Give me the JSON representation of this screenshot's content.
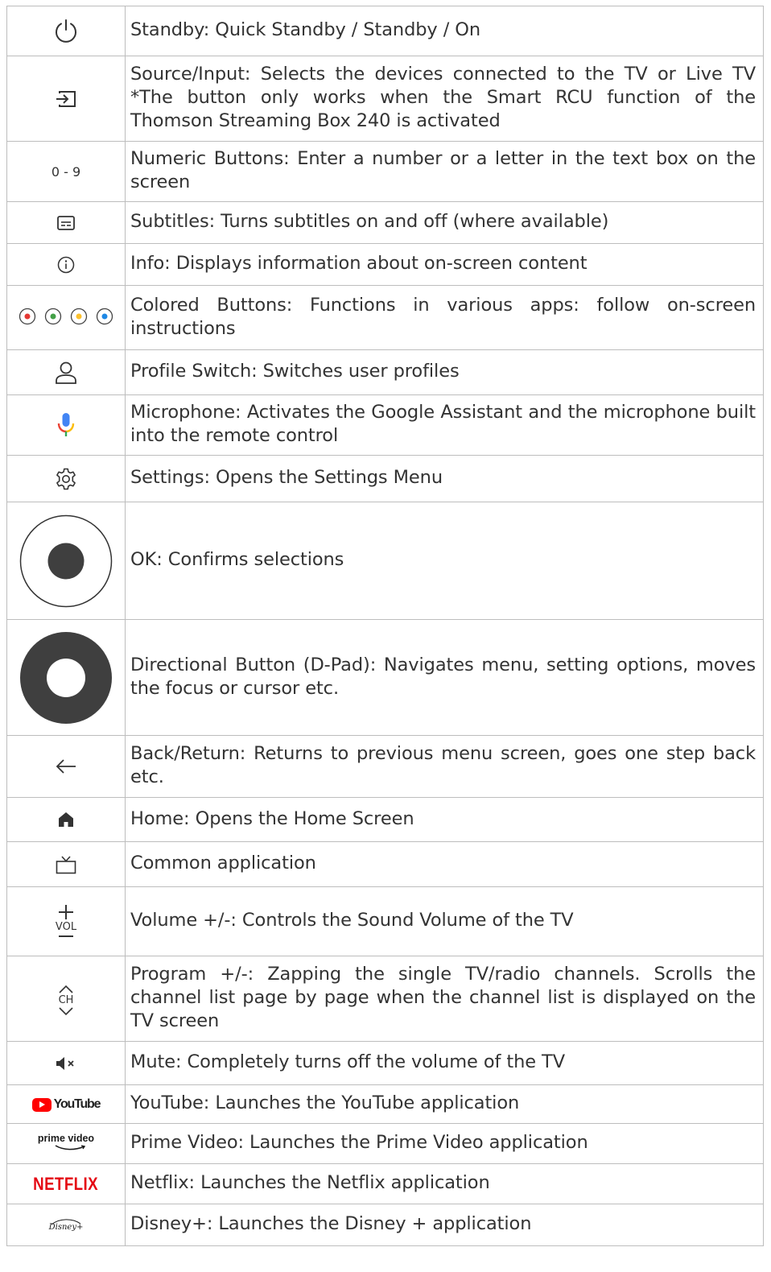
{
  "rows": [
    {
      "icon": "power-icon",
      "description": "Standby: Quick Standby / Standby / On"
    },
    {
      "icon": "source-input-icon",
      "description": "Source/Input: Selects the devices connected to the TV or Live TV *The button only works when the Smart RCU function of the Thomson Streaming Box 240 is activated"
    },
    {
      "icon": "numeric-text",
      "icon_text": "0 - 9",
      "description": "Numeric Buttons: Enter a number or a letter in the text box on the screen"
    },
    {
      "icon": "subtitles-icon",
      "description": "Subtitles: Turns subtitles on and off (where available)"
    },
    {
      "icon": "info-icon",
      "description": "Info: Displays information about on-screen content"
    },
    {
      "icon": "colored-buttons-icon",
      "colors": [
        "#e53935",
        "#43a047",
        "#fbc02d",
        "#1e88e5"
      ],
      "description": "Colored Buttons: Functions in various apps: follow on-screen instructions"
    },
    {
      "icon": "profile-icon",
      "description": "Profile Switch: Switches user profiles"
    },
    {
      "icon": "microphone-icon",
      "description": "Microphone: Activates the Google Assistant and the microphone built into the remote control"
    },
    {
      "icon": "settings-gear-icon",
      "description": "Settings: Opens the Settings Menu"
    },
    {
      "icon": "ok-button-icon",
      "description": "OK: Confirms selections"
    },
    {
      "icon": "dpad-icon",
      "description": "Directional Button (D-Pad): Navigates menu, setting options, moves the focus or cursor etc."
    },
    {
      "icon": "back-arrow-icon",
      "description": "Back/Return: Returns to previous menu screen, goes one step back etc."
    },
    {
      "icon": "home-icon",
      "description": "Home: Opens the Home Screen"
    },
    {
      "icon": "tv-icon",
      "description": "Common application"
    },
    {
      "icon": "volume-icon",
      "icon_text": "VOL",
      "description": "Volume +/-: Controls the Sound Volume of the TV"
    },
    {
      "icon": "channel-icon",
      "icon_text": "CH",
      "description": "Program +/-: Zapping the single TV/radio channels. Scrolls the channel list page by page when the channel list is displayed on the TV screen"
    },
    {
      "icon": "mute-icon",
      "description": "Mute: Completely turns off the volume of the TV"
    },
    {
      "icon": "youtube-logo",
      "logo_text": "YouTube",
      "description": "YouTube: Launches the YouTube application"
    },
    {
      "icon": "prime-video-logo",
      "logo_text": "prime video",
      "description": "Prime Video: Launches the Prime Video application"
    },
    {
      "icon": "netflix-logo",
      "logo_text": "NETFLIX",
      "description": "Netflix: Launches the Netflix application"
    },
    {
      "icon": "disney-plus-logo",
      "logo_text": "Disney+",
      "description": "Disney+: Launches the Disney + application"
    }
  ]
}
